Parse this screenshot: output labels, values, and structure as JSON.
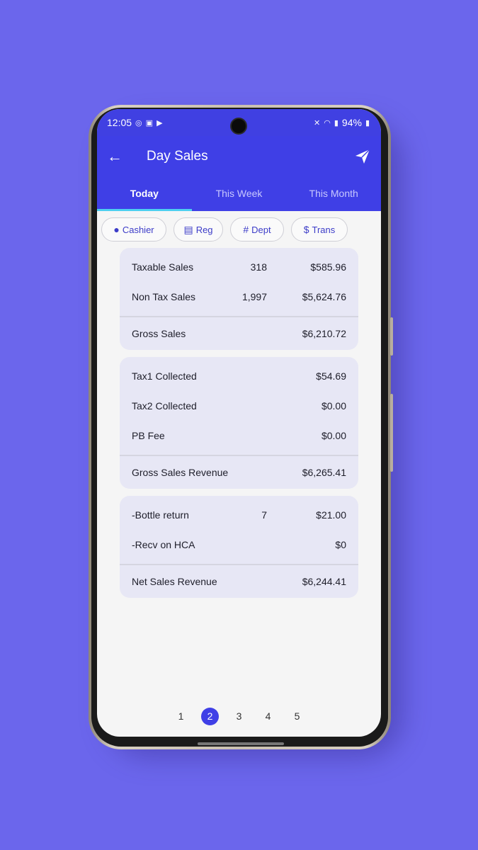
{
  "status": {
    "time": "12:05",
    "battery": "94%"
  },
  "appbar": {
    "title": "Day Sales"
  },
  "tabs": [
    {
      "label": "Today",
      "active": true
    },
    {
      "label": "This Week",
      "active": false
    },
    {
      "label": "This Month",
      "active": false
    }
  ],
  "filters": [
    {
      "label": "Cashier",
      "icon": "person-icon"
    },
    {
      "label": "Reg",
      "icon": "register-icon"
    },
    {
      "label": "Dept",
      "icon": "grid-icon"
    },
    {
      "label": "Trans",
      "icon": "dollar-icon"
    }
  ],
  "cards": [
    {
      "rows": [
        {
          "label": "Taxable Sales",
          "count": "318",
          "amount": "$585.96"
        },
        {
          "label": "Non Tax Sales",
          "count": "1,997",
          "amount": "$5,624.76"
        }
      ],
      "total": {
        "label": "Gross Sales",
        "amount": "$6,210.72"
      }
    },
    {
      "rows": [
        {
          "label": "Tax1 Collected",
          "count": "",
          "amount": "$54.69"
        },
        {
          "label": "Tax2 Collected",
          "count": "",
          "amount": "$0.00"
        },
        {
          "label": "PB Fee",
          "count": "",
          "amount": "$0.00"
        }
      ],
      "total": {
        "label": "Gross Sales Revenue",
        "amount": "$6,265.41"
      }
    },
    {
      "rows": [
        {
          "label": "-Bottle return",
          "count": "7",
          "amount": "$21.00"
        },
        {
          "label": "-Recv on HCA",
          "count": "",
          "amount": "$0"
        }
      ],
      "total": {
        "label": "Net Sales Revenue",
        "amount": "$6,244.41"
      }
    }
  ],
  "pager": {
    "pages": [
      "1",
      "2",
      "3",
      "4",
      "5"
    ],
    "active": "2"
  },
  "colors": {
    "primary": "#3f3fe6",
    "background": "#6b66ec",
    "card": "#e7e7f5"
  }
}
